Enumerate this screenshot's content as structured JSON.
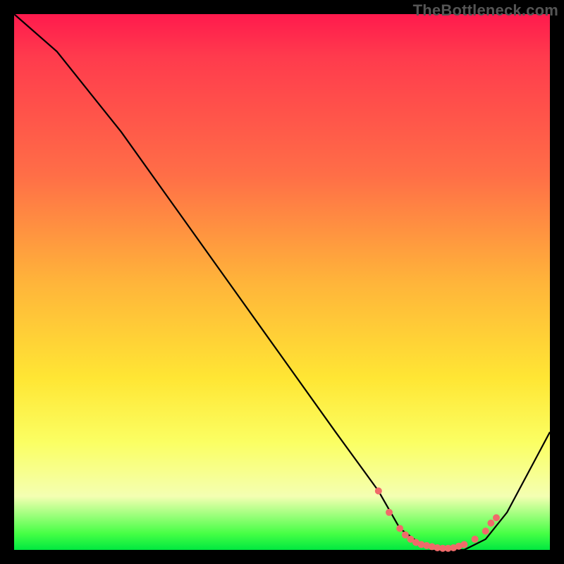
{
  "watermark": "TheBottleneck.com",
  "chart_data": {
    "type": "line",
    "title": "",
    "xlabel": "",
    "ylabel": "",
    "xlim": [
      0,
      100
    ],
    "ylim": [
      0,
      100
    ],
    "series": [
      {
        "name": "bottleneck-curve",
        "x": [
          0,
          8,
          20,
          30,
          40,
          50,
          60,
          68,
          72,
          76,
          80,
          84,
          88,
          92,
          100
        ],
        "values": [
          100,
          93,
          78,
          64,
          50,
          36,
          22,
          11,
          4,
          1,
          0,
          0,
          2,
          7,
          22
        ]
      }
    ],
    "markers": {
      "name": "highlight-dots",
      "x": [
        68,
        70,
        72,
        73,
        74,
        75,
        76,
        77,
        78,
        79,
        80,
        81,
        82,
        83,
        84,
        86,
        88,
        89,
        90
      ],
      "values": [
        11,
        7,
        4,
        2.8,
        2,
        1.4,
        1,
        0.8,
        0.6,
        0.4,
        0.3,
        0.3,
        0.4,
        0.7,
        1,
        2,
        3.5,
        5,
        6
      ]
    }
  },
  "colors": {
    "curve": "#000000",
    "dots": "#f06a6a"
  }
}
